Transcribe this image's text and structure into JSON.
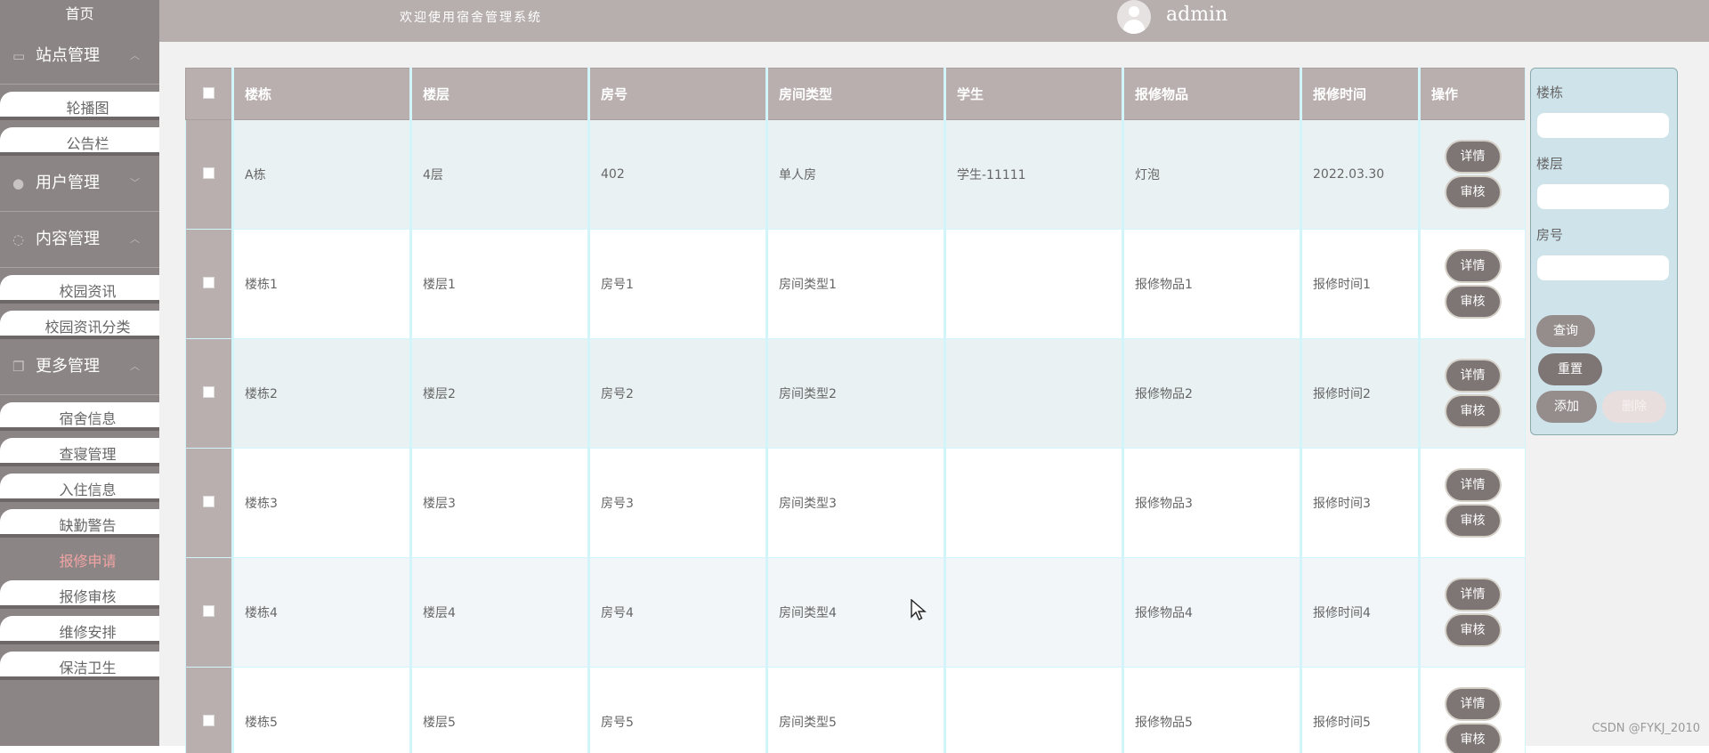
{
  "sidebar": {
    "home": "首页",
    "sections": [
      {
        "label": "站点管理",
        "items": [
          "轮播图",
          "公告栏"
        ]
      },
      {
        "label": "用户管理",
        "items": []
      },
      {
        "label": "内容管理",
        "items": [
          "校园资讯",
          "校园资讯分类"
        ]
      },
      {
        "label": "更多管理",
        "items": [
          "宿舍信息",
          "查寝管理",
          "入住信息",
          "缺勤警告",
          "报修申请",
          "报修审核",
          "维修安排",
          "保洁卫生"
        ]
      }
    ],
    "active_item": "报修申请"
  },
  "header": {
    "welcome": "欢迎使用宿舍管理系统",
    "username": "admin"
  },
  "table": {
    "columns": [
      "楼栋",
      "楼层",
      "房号",
      "房间类型",
      "学生",
      "报修物品",
      "报修时间",
      "操作"
    ],
    "rows": [
      [
        "A栋",
        "4层",
        "402",
        "单人房",
        "学生-11111",
        "灯泡",
        "2022.03.30"
      ],
      [
        "楼栋1",
        "楼层1",
        "房号1",
        "房间类型1",
        "",
        "报修物品1",
        "报修时间1"
      ],
      [
        "楼栋2",
        "楼层2",
        "房号2",
        "房间类型2",
        "",
        "报修物品2",
        "报修时间2"
      ],
      [
        "楼栋3",
        "楼层3",
        "房号3",
        "房间类型3",
        "",
        "报修物品3",
        "报修时间3"
      ],
      [
        "楼栋4",
        "楼层4",
        "房号4",
        "房间类型4",
        "",
        "报修物品4",
        "报修时间4"
      ],
      [
        "楼栋5",
        "楼层5",
        "房号5",
        "房间类型5",
        "",
        "报修物品5",
        "报修时间5"
      ]
    ],
    "row_actions": {
      "detail": "详情",
      "review": "审核"
    }
  },
  "search": {
    "building_label": "楼栋",
    "floor_label": "楼层",
    "room_label": "房号",
    "building_value": "",
    "floor_value": "",
    "room_value": "",
    "query": "查询",
    "reset": "重置",
    "add": "添加",
    "delete": "删除"
  },
  "watermark": "CSDN @FYKJ_2010",
  "colors": {
    "sidebar_bg": "#8c8585",
    "topbar_bg": "#b7aeae",
    "header_cell_bg": "#b9afaf",
    "button_bg": "#7e7575",
    "active_item": "#f2a4a4",
    "search_panel_bg": "#cfe3ea"
  }
}
